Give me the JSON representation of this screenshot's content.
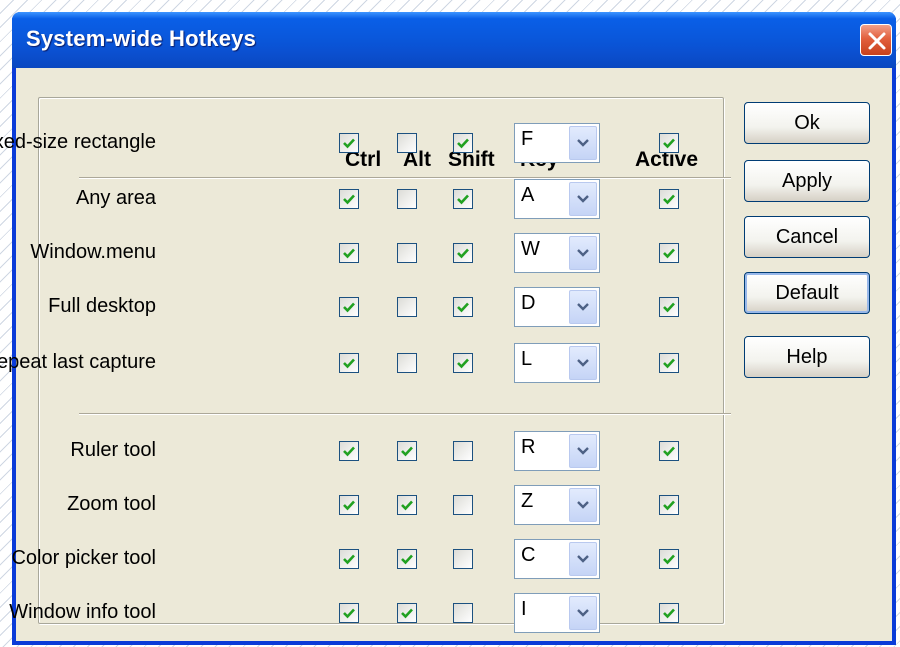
{
  "window": {
    "title": "System-wide Hotkeys"
  },
  "columns": {
    "ctrl": "Ctrl",
    "alt": "Alt",
    "shift": "Shift",
    "key": "Key",
    "active": "Active"
  },
  "capture_rows": [
    {
      "label": "Fixed-size rectangle",
      "ctrl": true,
      "alt": false,
      "shift": true,
      "key": "F",
      "active": true
    },
    {
      "label": "Any area",
      "ctrl": true,
      "alt": false,
      "shift": true,
      "key": "A",
      "active": true
    },
    {
      "label": "Window.menu",
      "ctrl": true,
      "alt": false,
      "shift": true,
      "key": "W",
      "active": true
    },
    {
      "label": "Full desktop",
      "ctrl": true,
      "alt": false,
      "shift": true,
      "key": "D",
      "active": true
    },
    {
      "label": "Repeat last capture",
      "ctrl": true,
      "alt": false,
      "shift": true,
      "key": "L",
      "active": true
    }
  ],
  "tool_rows": [
    {
      "label": "Ruler tool",
      "ctrl": true,
      "alt": true,
      "shift": false,
      "key": "R",
      "active": true
    },
    {
      "label": "Zoom tool",
      "ctrl": true,
      "alt": true,
      "shift": false,
      "key": "Z",
      "active": true
    },
    {
      "label": "Color picker tool",
      "ctrl": true,
      "alt": true,
      "shift": false,
      "key": "C",
      "active": true
    },
    {
      "label": "Window info tool",
      "ctrl": true,
      "alt": true,
      "shift": false,
      "key": "I",
      "active": true
    }
  ],
  "buttons": {
    "ok": "Ok",
    "apply": "Apply",
    "cancel": "Cancel",
    "default": "Default",
    "help": "Help"
  },
  "colors": {
    "titlebar": "#0a58dc",
    "dialog": "#ece9d8",
    "check": "#21a121",
    "close": "#e2603d"
  },
  "icons": {
    "close": "close-x-icon",
    "check": "checkmark-icon",
    "dropdown": "chevron-down-icon"
  }
}
